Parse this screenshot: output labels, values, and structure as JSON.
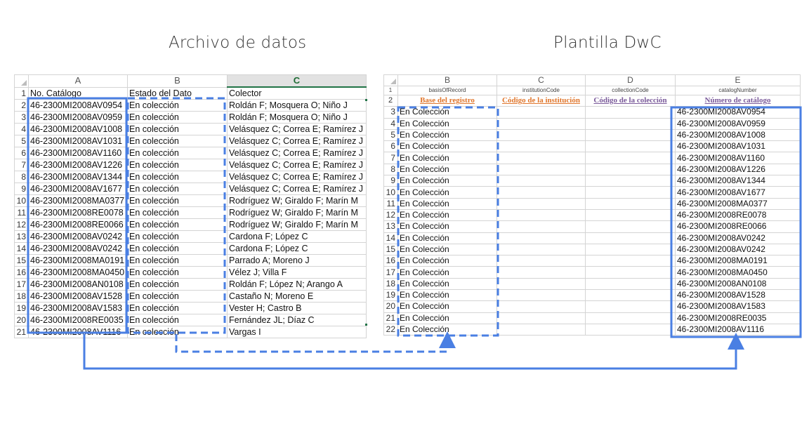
{
  "titles": {
    "left": "Archivo de datos",
    "right": "Plantilla DwC"
  },
  "left_sheet": {
    "columns": [
      "A",
      "B",
      "C"
    ],
    "rows": [
      {
        "n": "1",
        "a": "No. Catálogo",
        "b": "Estado del Dato",
        "c": "Colector"
      },
      {
        "n": "2",
        "a": "46-2300MI2008AV0954",
        "b": "En colección",
        "c": "Roldán F; Mosquera O; Niño J"
      },
      {
        "n": "3",
        "a": "46-2300MI2008AV0959",
        "b": "En colección",
        "c": "Roldán F; Mosquera O; Niño J"
      },
      {
        "n": "4",
        "a": "46-2300MI2008AV1008",
        "b": "En colección",
        "c": "Velásquez C; Correa E; Ramírez J"
      },
      {
        "n": "5",
        "a": "46-2300MI2008AV1031",
        "b": "En colección",
        "c": "Velásquez C; Correa E; Ramírez J"
      },
      {
        "n": "6",
        "a": "46-2300MI2008AV1160",
        "b": "En colección",
        "c": "Velásquez C; Correa E; Ramírez J"
      },
      {
        "n": "7",
        "a": "46-2300MI2008AV1226",
        "b": "En colección",
        "c": "Velásquez C; Correa E; Ramírez J"
      },
      {
        "n": "8",
        "a": "46-2300MI2008AV1344",
        "b": "En colección",
        "c": "Velásquez C; Correa E; Ramírez J"
      },
      {
        "n": "9",
        "a": "46-2300MI2008AV1677",
        "b": "En colección",
        "c": "Velásquez C; Correa E; Ramírez J"
      },
      {
        "n": "10",
        "a": "46-2300MI2008MA0377",
        "b": "En colección",
        "c": "Rodríguez W; Giraldo F; Marín M"
      },
      {
        "n": "11",
        "a": "46-2300MI2008RE0078",
        "b": "En colección",
        "c": "Rodríguez W; Giraldo F; Marín M"
      },
      {
        "n": "12",
        "a": "46-2300MI2008RE0066",
        "b": "En colección",
        "c": "Rodríguez W; Giraldo F; Marín M"
      },
      {
        "n": "13",
        "a": "46-2300MI2008AV0242",
        "b": "En colección",
        "c": "Cardona F; López C"
      },
      {
        "n": "14",
        "a": "46-2300MI2008AV0242",
        "b": "En colección",
        "c": "Cardona F; López C"
      },
      {
        "n": "15",
        "a": "46-2300MI2008MA0191",
        "b": "En colección",
        "c": "Parrado A; Moreno J"
      },
      {
        "n": "16",
        "a": "46-2300MI2008MA0450",
        "b": "En colección",
        "c": "Vélez J; Villa F"
      },
      {
        "n": "17",
        "a": "46-2300MI2008AN0108",
        "b": "En colección",
        "c": "Roldán F; López N; Arango A"
      },
      {
        "n": "18",
        "a": "46-2300MI2008AV1528",
        "b": "En colección",
        "c": "Castaño N; Moreno E"
      },
      {
        "n": "19",
        "a": "46-2300MI2008AV1583",
        "b": "En colección",
        "c": "Vester H; Castro B"
      },
      {
        "n": "20",
        "a": "46-2300MI2008RE0035",
        "b": "En colección",
        "c": "Fernández JL; Díaz C"
      },
      {
        "n": "21",
        "a": "46-2300MI2008AV1116",
        "b": "En colección",
        "c": "Vargas I"
      }
    ]
  },
  "right_sheet": {
    "columns": [
      "B",
      "C",
      "D",
      "E"
    ],
    "field_names": [
      "basisOfRecord",
      "institutionCode",
      "collectionCode",
      "catalogNumber"
    ],
    "field_labels": [
      "Base del registro",
      "Código de la institución",
      "Código de la colección",
      "Número de catálogo"
    ],
    "rows": [
      {
        "n": "3",
        "b": "En Colección",
        "e": "46-2300MI2008AV0954"
      },
      {
        "n": "4",
        "b": "En Colección",
        "e": "46-2300MI2008AV0959"
      },
      {
        "n": "5",
        "b": "En Colección",
        "e": "46-2300MI2008AV1008"
      },
      {
        "n": "6",
        "b": "En Colección",
        "e": "46-2300MI2008AV1031"
      },
      {
        "n": "7",
        "b": "En Colección",
        "e": "46-2300MI2008AV1160"
      },
      {
        "n": "8",
        "b": "En Colección",
        "e": "46-2300MI2008AV1226"
      },
      {
        "n": "9",
        "b": "En Colección",
        "e": "46-2300MI2008AV1344"
      },
      {
        "n": "10",
        "b": "En Colección",
        "e": "46-2300MI2008AV1677"
      },
      {
        "n": "11",
        "b": "En Colección",
        "e": "46-2300MI2008MA0377"
      },
      {
        "n": "12",
        "b": "En Colección",
        "e": "46-2300MI2008RE0078"
      },
      {
        "n": "13",
        "b": "En Colección",
        "e": "46-2300MI2008RE0066"
      },
      {
        "n": "14",
        "b": "En Colección",
        "e": "46-2300MI2008AV0242"
      },
      {
        "n": "15",
        "b": "En Colección",
        "e": "46-2300MI2008AV0242"
      },
      {
        "n": "16",
        "b": "En Colección",
        "e": "46-2300MI2008MA0191"
      },
      {
        "n": "17",
        "b": "En Colección",
        "e": "46-2300MI2008MA0450"
      },
      {
        "n": "18",
        "b": "En Colección",
        "e": "46-2300MI2008AN0108"
      },
      {
        "n": "19",
        "b": "En Colección",
        "e": "46-2300MI2008AV1528"
      },
      {
        "n": "20",
        "b": "En Colección",
        "e": "46-2300MI2008AV1583"
      },
      {
        "n": "21",
        "b": "En Colección",
        "e": "46-2300MI2008RE0035"
      },
      {
        "n": "22",
        "b": "En Colección",
        "e": "46-2300MI2008AV1116"
      }
    ]
  },
  "colors": {
    "highlight": "#4a7fe3",
    "orange_label": "#e0762c",
    "purple_label": "#7a5a9a",
    "selected_header": "#217346"
  }
}
